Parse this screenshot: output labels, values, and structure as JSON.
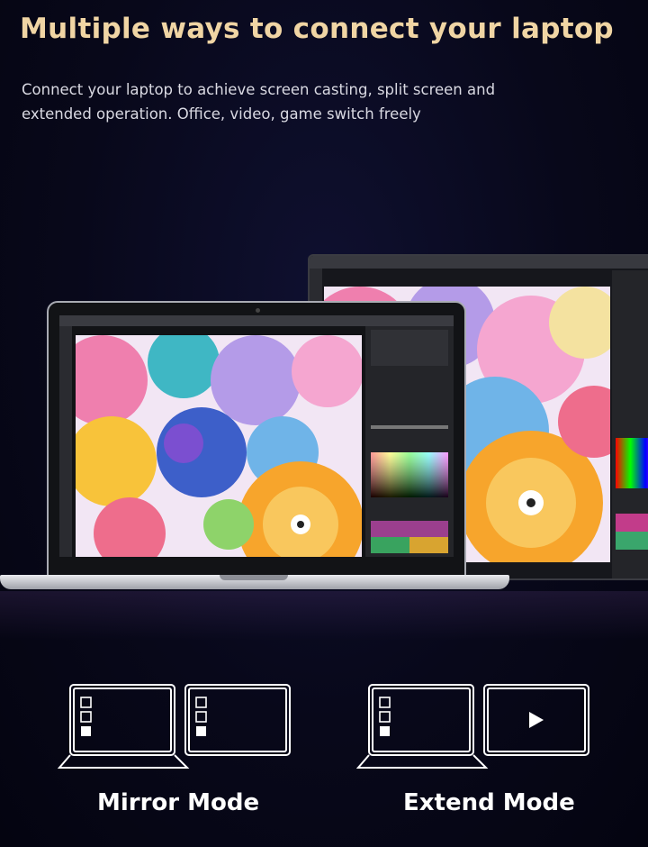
{
  "headline": "Multiple ways to connect your laptop",
  "subline": "Connect your laptop to achieve screen casting, split screen and extended operation. Office, video, game switch freely",
  "modes": [
    {
      "label": "Mirror Mode",
      "second_screen_icon": "sidebar-icon"
    },
    {
      "label": "Extend Mode",
      "second_screen_icon": "play-icon"
    }
  ],
  "colors": {
    "headline": "#f0d5a4",
    "background": "#08081a",
    "text": "#ffffff"
  }
}
